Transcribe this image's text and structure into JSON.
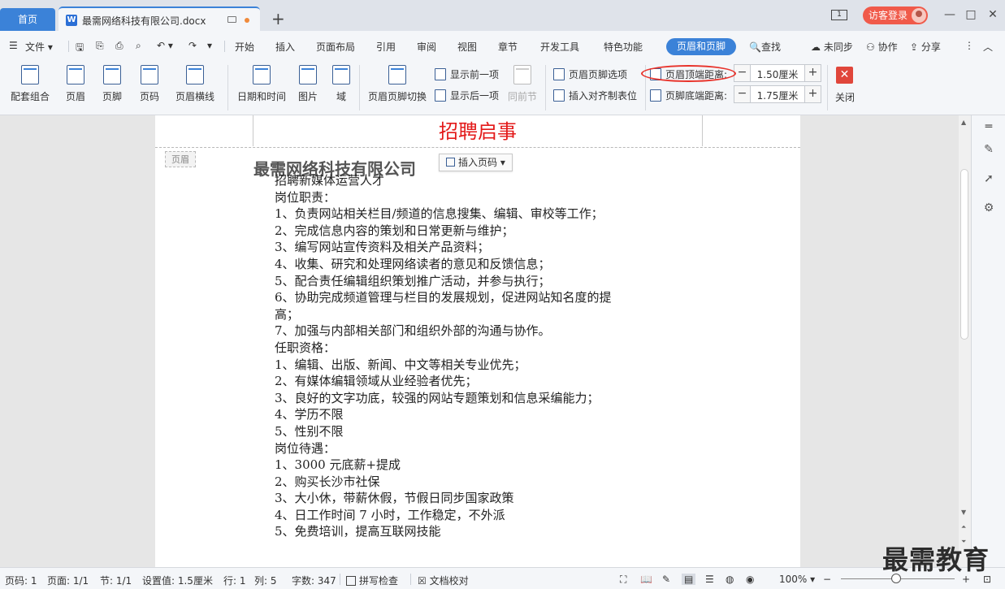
{
  "titlebar": {
    "home_tab": "首页",
    "doc_tab": "最需网络科技有限公司.docx",
    "window_badge": "1",
    "login": "访客登录",
    "minimize": "—",
    "maximize": "□",
    "close": "✕"
  },
  "menu": {
    "file": "文件",
    "tabs": [
      "开始",
      "插入",
      "页面布局",
      "引用",
      "审阅",
      "视图",
      "章节",
      "开发工具",
      "特色功能"
    ],
    "active_tab": "页眉和页脚",
    "search": "查找",
    "sync": "未同步",
    "collab": "协作",
    "share": "分享"
  },
  "ribbon": {
    "buttons": [
      "配套组合",
      "页眉",
      "页脚",
      "页码",
      "页眉横线",
      "日期和时间",
      "图片",
      "域",
      "页眉页脚切换"
    ],
    "show_prev": "显示前一项",
    "show_next": "显示后一项",
    "same_as_prev": "同前节",
    "hf_options": "页眉页脚选项",
    "insert_align_tab": "插入对齐制表位",
    "header_top_label": "页眉顶端距离:",
    "header_top_value": "1.50厘米",
    "footer_bottom_label": "页脚底端距离:",
    "footer_bottom_value": "1.75厘米",
    "close": "关闭"
  },
  "document": {
    "header_title": "招聘启事",
    "header_tag": "页眉",
    "company": "最需网络科技有限公司",
    "insert_page_number": "插入页码",
    "lines": [
      "招聘新媒体运营人才",
      "岗位职责：",
      "1、负责网站相关栏目/频道的信息搜集、编辑、审校等工作；",
      "2、完成信息内容的策划和日常更新与维护；",
      "3、编写网站宣传资料及相关产品资料；",
      "4、收集、研究和处理网络读者的意见和反馈信息；",
      "5、配合责任编辑组织策划推广活动，并参与执行；",
      "6、协助完成频道管理与栏目的发展规划，促进网站知名度的提",
      "高；",
      "7、加强与内部相关部门和组织外部的沟通与协作。",
      "    任职资格：",
      "1、编辑、出版、新闻、中文等相关专业优先；",
      "2、有媒体编辑领域从业经验者优先；",
      "3、良好的文字功底，较强的网站专题策划和信息采编能力；",
      "4、学历不限",
      "5、性别不限",
      "    岗位待遇：",
      "1、3000 元底薪+提成",
      "2、购买长沙市社保",
      "3、大小休，带薪休假，节假日同步国家政策",
      "4、日工作时间 7 小时，工作稳定，不外派",
      "5、免费培训，提高互联网技能"
    ]
  },
  "status": {
    "page_num": "页码: 1",
    "pages": "页面: 1/1",
    "section": "节: 1/1",
    "setting": "设置值: 1.5厘米",
    "row": "行: 1",
    "col": "列: 5",
    "words": "字数: 347",
    "spellcheck": "拼写检查",
    "proof": "文档校对",
    "zoom": "100%"
  },
  "watermark": "最需教育"
}
